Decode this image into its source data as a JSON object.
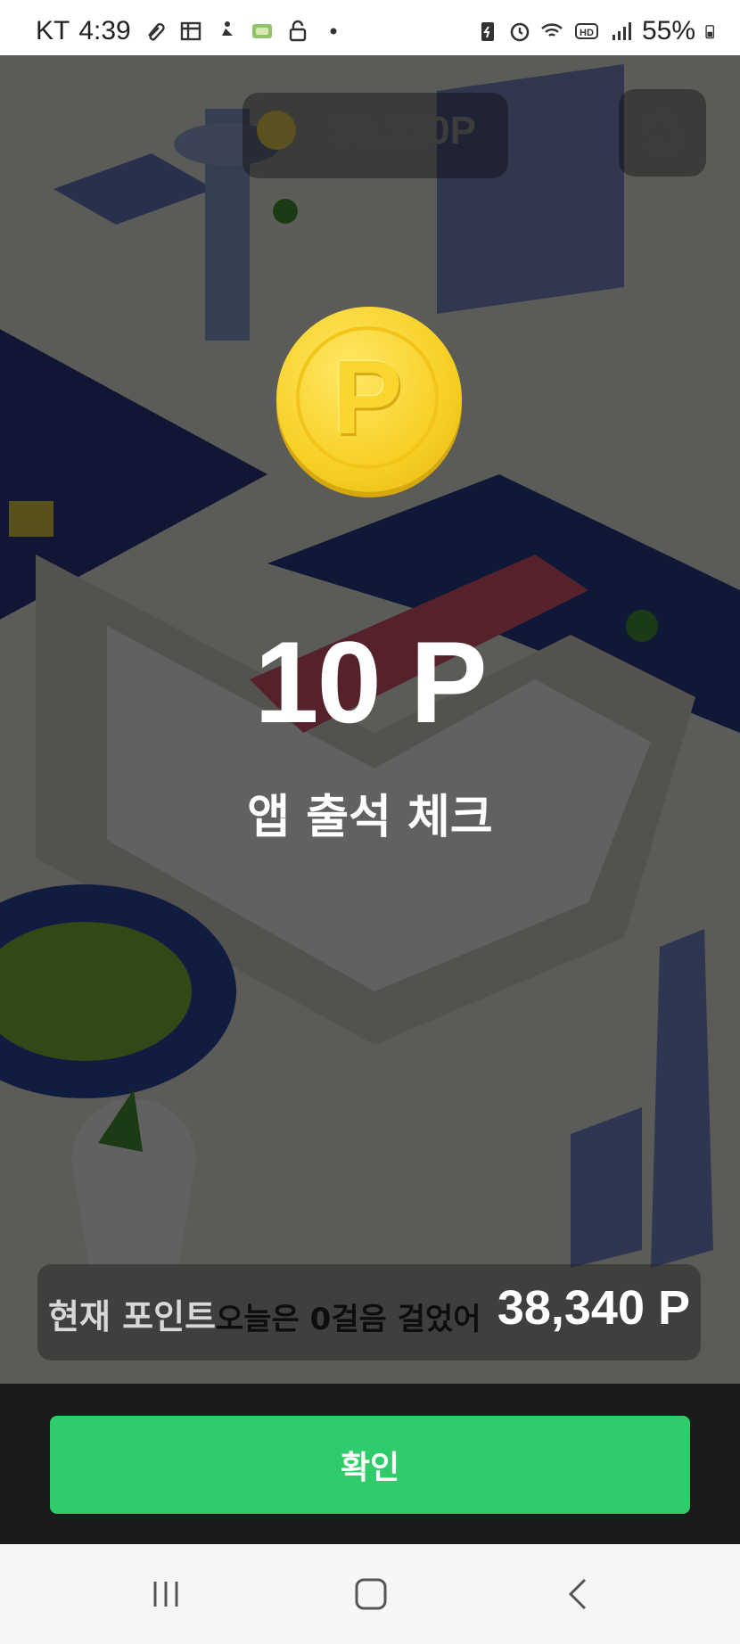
{
  "status_bar": {
    "carrier": "KT",
    "time": "4:39",
    "battery": "55%",
    "icons_left": [
      "clip-icon",
      "grid-icon",
      "figure-icon",
      "app-badge-icon",
      "lock-icon",
      "dot-icon"
    ],
    "icons_right": [
      "battery-saver-icon",
      "alarm-icon",
      "wifi-icon",
      "hd-icon",
      "signal-icon",
      "battery-icon"
    ]
  },
  "background": {
    "top_points": "38,330P",
    "refresh_icon": "refresh-icon"
  },
  "reward": {
    "coin_letter": "P",
    "amount": "10 P",
    "label": "앱 출석 체크"
  },
  "points": {
    "label": "현재 포인트",
    "overlay_text": "오늘은 0걸음 걸었어",
    "value": "38,340 P"
  },
  "confirm": {
    "label": "확인"
  },
  "navbar": {
    "items": [
      "recent-apps-icon",
      "home-icon",
      "back-icon"
    ]
  },
  "colors": {
    "accent": "#2ecc6a",
    "coin": "#f7cf24"
  }
}
